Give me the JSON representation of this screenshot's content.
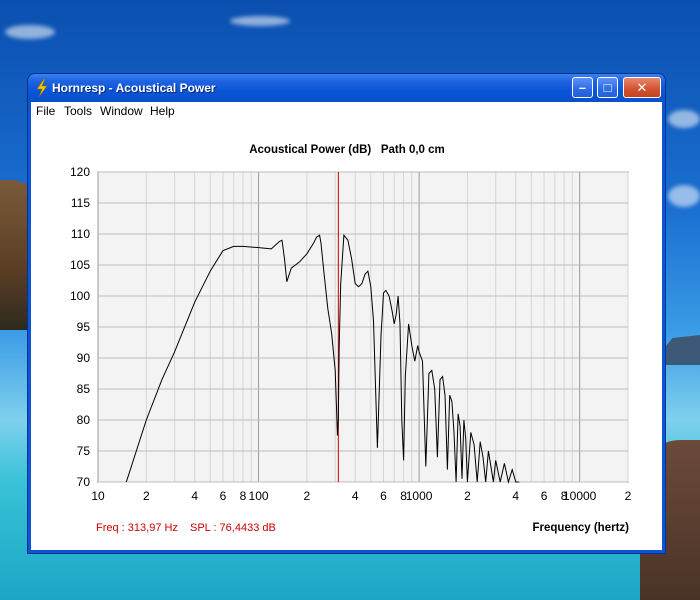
{
  "window": {
    "title": "Hornresp - Acoustical Power"
  },
  "menu": {
    "items": [
      "File",
      "Tools",
      "Window",
      "Help"
    ]
  },
  "titlebar": {
    "minimize_glyph": "–",
    "maximize_glyph": "□",
    "close_glyph": "✕"
  },
  "colors": {
    "cursor": "#cc0000",
    "trace": "#000000",
    "readout": "#cc0000",
    "plot_bg": "#f3f3f3"
  },
  "readout": {
    "freq": "Freq : 313,97 Hz",
    "spl": "SPL : 76,4433 dB"
  },
  "chart_data": {
    "type": "line",
    "title": "Acoustical Power (dB)   Path 0,0 cm",
    "xlabel": "Frequency (hertz)",
    "ylabel": "",
    "x_scale": "log",
    "xlim": [
      10,
      20000
    ],
    "ylim": [
      70,
      120
    ],
    "grid": true,
    "yticks": [
      120,
      115,
      110,
      105,
      100,
      95,
      90,
      85,
      80,
      75,
      70
    ],
    "xtick_labels": [
      {
        "v": 10,
        "t": "10"
      },
      {
        "v": 20,
        "t": "2"
      },
      {
        "v": 40,
        "t": "4"
      },
      {
        "v": 60,
        "t": "6"
      },
      {
        "v": 80,
        "t": "8"
      },
      {
        "v": 100,
        "t": "100"
      },
      {
        "v": 200,
        "t": "2"
      },
      {
        "v": 400,
        "t": "4"
      },
      {
        "v": 600,
        "t": "6"
      },
      {
        "v": 800,
        "t": "8"
      },
      {
        "v": 1000,
        "t": "1000"
      },
      {
        "v": 2000,
        "t": "2"
      },
      {
        "v": 4000,
        "t": "4"
      },
      {
        "v": 6000,
        "t": "6"
      },
      {
        "v": 8000,
        "t": "8"
      },
      {
        "v": 10000,
        "t": "10000"
      },
      {
        "v": 20000,
        "t": "2"
      }
    ],
    "cursor_freq": 313.97,
    "series": [
      {
        "x": [
          15,
          20,
          25,
          30,
          40,
          50,
          60,
          70,
          80,
          100,
          120,
          135,
          140,
          145,
          150,
          160,
          180,
          200,
          220,
          230,
          240,
          245,
          255,
          270,
          285,
          300,
          306,
          310,
          313.97,
          318,
          325,
          340,
          360,
          380,
          400,
          420,
          440,
          460,
          480,
          500,
          520,
          550,
          580,
          590,
          600,
          620,
          650,
          680,
          700,
          720,
          740,
          760,
          780,
          800,
          820,
          860,
          900,
          940,
          980,
          1000,
          1050,
          1100,
          1150,
          1200,
          1250,
          1300,
          1350,
          1400,
          1450,
          1500,
          1550,
          1600,
          1650,
          1700,
          1750,
          1800,
          1850,
          1900,
          1950,
          2000,
          2100,
          2200,
          2300,
          2400,
          2500,
          2600,
          2700,
          2800,
          2900,
          3000,
          3200,
          3400,
          3600,
          3800,
          4000,
          4200
        ],
        "y": [
          70,
          80,
          86.5,
          91,
          99,
          104,
          107.3,
          108,
          108,
          107.8,
          107.6,
          108.8,
          109,
          106,
          102.3,
          104.5,
          105.5,
          106.8,
          108.5,
          109.5,
          109.8,
          108.5,
          104,
          98,
          94,
          88,
          82,
          77.5,
          80,
          92,
          102,
          109.8,
          109,
          106,
          102,
          101.5,
          102,
          103.5,
          104,
          101.5,
          96,
          75.5,
          94,
          97,
          100.5,
          100.9,
          100,
          97.5,
          95.5,
          97,
          100,
          95.5,
          80,
          73.5,
          87,
          95.5,
          92,
          89.5,
          92,
          91,
          89.5,
          72.5,
          87.5,
          88,
          85,
          74,
          86.5,
          87,
          84,
          72,
          84,
          83,
          78,
          70,
          81,
          79,
          70.5,
          80,
          77,
          70,
          78,
          76,
          70,
          76.5,
          74,
          70,
          75,
          72.5,
          70,
          73.5,
          70,
          73,
          70,
          72,
          70,
          70
        ]
      }
    ]
  }
}
